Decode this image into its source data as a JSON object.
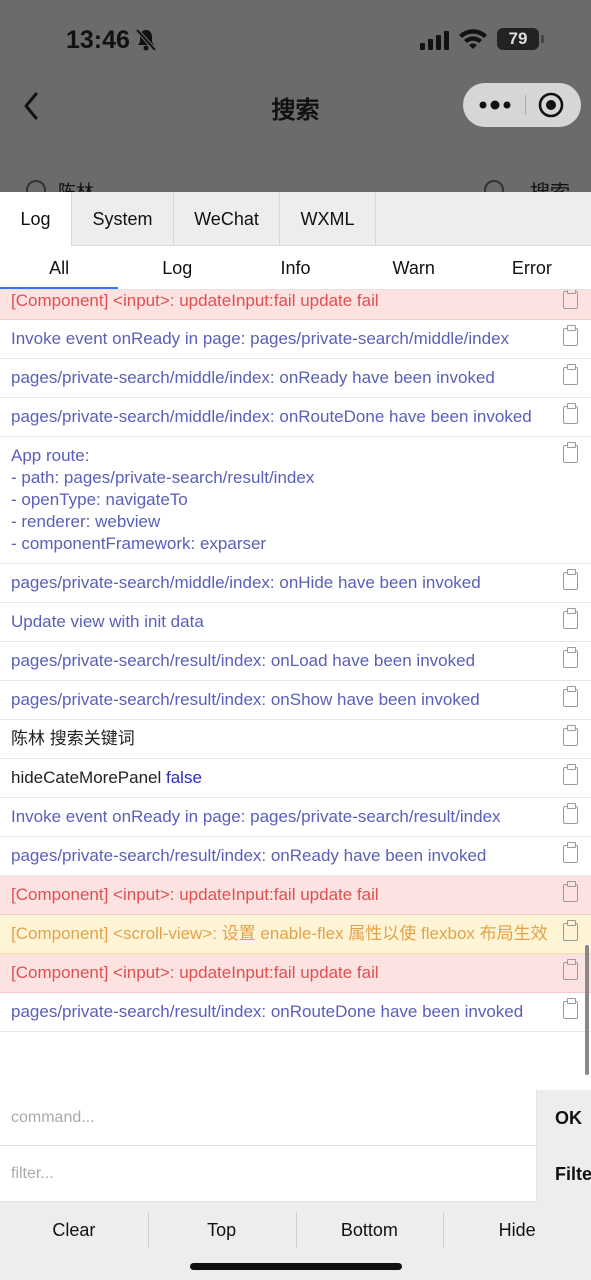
{
  "status_bar": {
    "time": "13:46",
    "battery": "79"
  },
  "nav": {
    "title": "搜索"
  },
  "search": {
    "query": "陈林",
    "button": "搜索"
  },
  "tabs": [
    "Log",
    "System",
    "WeChat",
    "WXML"
  ],
  "subtabs": [
    "All",
    "Log",
    "Info",
    "Warn",
    "Error"
  ],
  "logs": [
    {
      "level": "error",
      "text": "[Component] <input>: updateInput:fail update fail"
    },
    {
      "level": "info",
      "text": "Invoke event onReady in page: pages/private-search/middle/index"
    },
    {
      "level": "info",
      "text": "pages/private-search/middle/index: onReady have been invoked"
    },
    {
      "level": "info",
      "text": "pages/private-search/middle/index: onRouteDone have been invoked"
    },
    {
      "level": "info",
      "text": "App route:\n- path: pages/private-search/result/index\n- openType: navigateTo\n- renderer: webview\n- componentFramework: exparser"
    },
    {
      "level": "info",
      "text": "pages/private-search/middle/index: onHide have been invoked"
    },
    {
      "level": "info",
      "text": "Update view with init data"
    },
    {
      "level": "info",
      "text": "pages/private-search/result/index: onLoad have been invoked"
    },
    {
      "level": "info",
      "text": "pages/private-search/result/index: onShow have been invoked"
    },
    {
      "level": "log",
      "text": "陈林 搜索关键词"
    },
    {
      "level": "log",
      "text": "hideCateMorePanel ",
      "value": "false"
    },
    {
      "level": "info",
      "text": "Invoke event onReady in page: pages/private-search/result/index"
    },
    {
      "level": "info",
      "text": "pages/private-search/result/index: onReady have been invoked"
    },
    {
      "level": "error",
      "text": "[Component] <input>: updateInput:fail update fail"
    },
    {
      "level": "warn",
      "text": "[Component] <scroll-view>: 设置 enable-flex 属性以使 flexbox 布局生效"
    },
    {
      "level": "error",
      "text": "[Component] <input>: updateInput:fail update fail"
    },
    {
      "level": "info",
      "text": "pages/private-search/result/index: onRouteDone have been invoked"
    }
  ],
  "command": {
    "placeholder": "command...",
    "button": "OK"
  },
  "filter": {
    "placeholder": "filter...",
    "button": "Filter"
  },
  "toolbar": [
    "Clear",
    "Top",
    "Bottom",
    "Hide"
  ],
  "colors": {
    "info": "#5a5fb8",
    "error_bg": "#fde2e2",
    "warn_bg": "#fff5d6",
    "accent": "#3875f0"
  }
}
